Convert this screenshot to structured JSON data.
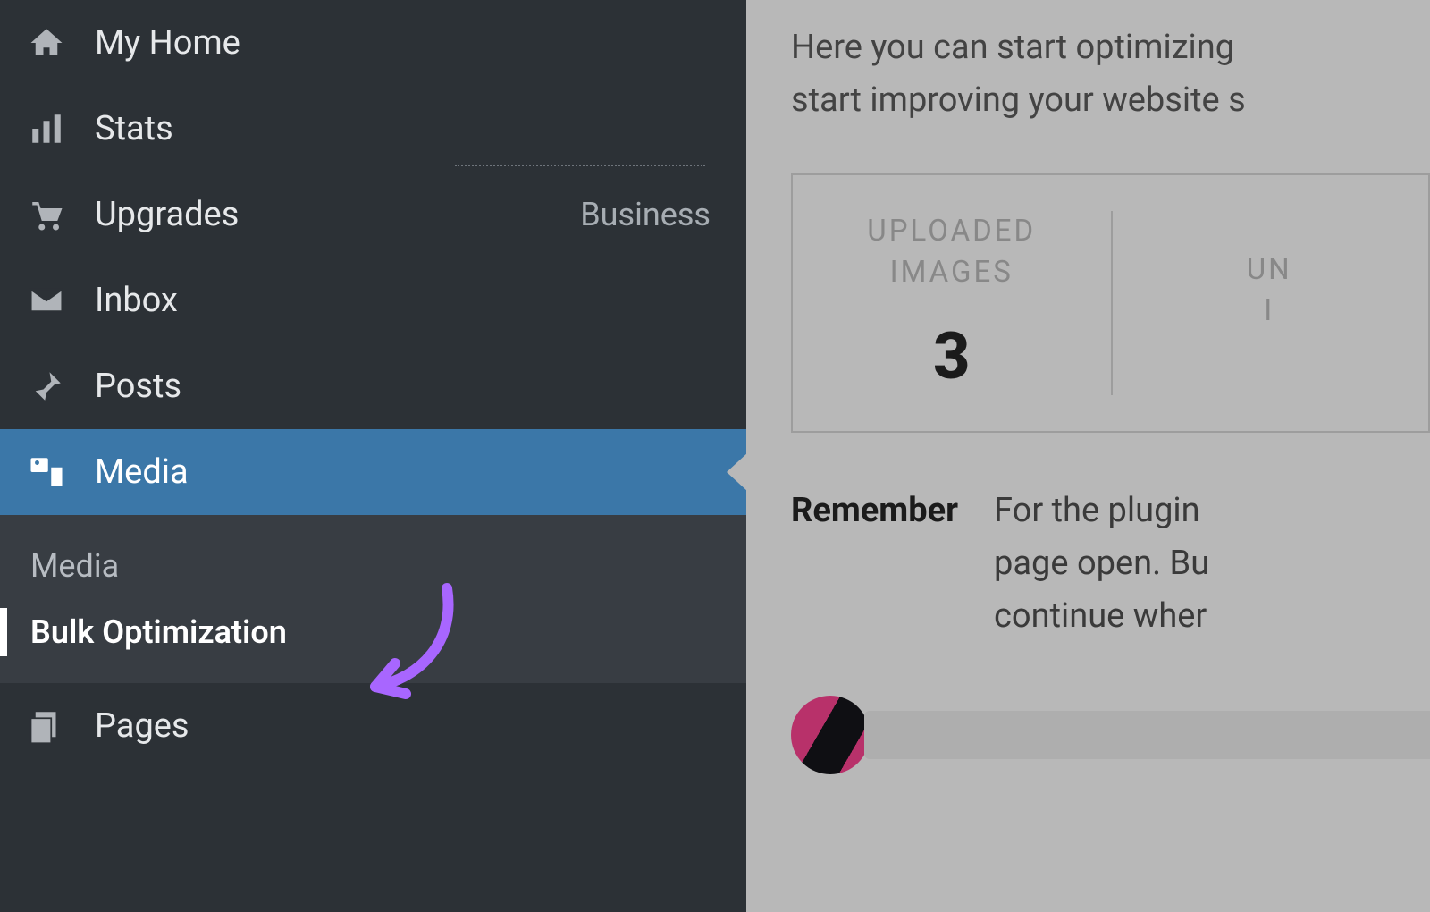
{
  "sidebar": {
    "items": [
      {
        "label": "My Home"
      },
      {
        "label": "Stats"
      },
      {
        "label": "Upgrades",
        "right": "Business"
      },
      {
        "label": "Inbox"
      },
      {
        "label": "Posts"
      },
      {
        "label": "Media"
      },
      {
        "label": "Pages"
      }
    ],
    "submenu": {
      "heading": "Media",
      "items": [
        {
          "label": "Bulk Optimization"
        }
      ]
    }
  },
  "content": {
    "intro_line1": "Here you can start optimizing",
    "intro_line2": "start improving your website s",
    "stats": [
      {
        "label_l1": "UPLOADED",
        "label_l2": "IMAGES",
        "value": "3"
      },
      {
        "label_l1": "UN",
        "label_l2": "I",
        "value": ""
      }
    ],
    "remember": {
      "label": "Remember",
      "line1": "For the plugin",
      "line2": "page open. Bu",
      "line3": "continue wher"
    }
  }
}
